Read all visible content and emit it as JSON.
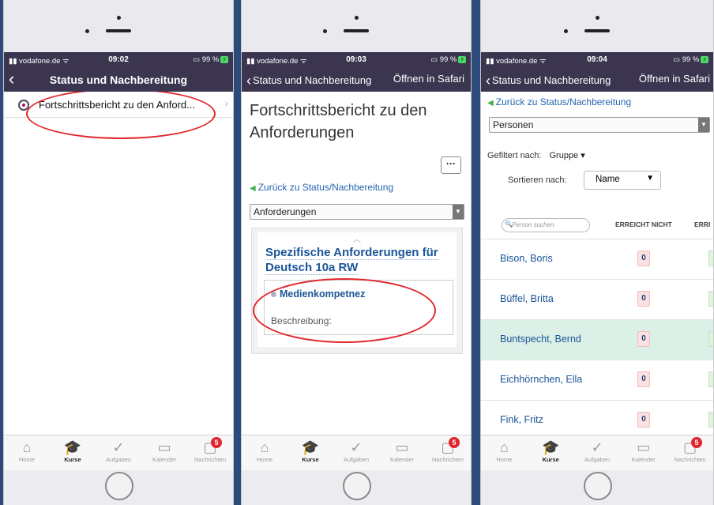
{
  "status": {
    "carrier": "vodafone.de",
    "battery": "99 %",
    "times": [
      "09:02",
      "09:03",
      "09:04"
    ]
  },
  "screen1": {
    "nav_title": "Status und Nachbereitung",
    "item_label": "Fortschrittsbericht zu den Anford..."
  },
  "screen2": {
    "nav_back": "Status und Nachbereitung",
    "nav_right": "Öffnen in Safari",
    "heading": "Fortschrittsbericht zu den Anforderungen",
    "more_button": "···",
    "back_link": "Zurück zu Status/Nachbereitung",
    "select_value": "Anforderungen",
    "spec_title": "Spezifische Anforderungen für Deutsch 10a RW",
    "competence": "Medienkompetnez",
    "description": "Beschreibung:"
  },
  "screen3": {
    "nav_back": "Status und Nachbereitung",
    "nav_right": "Öffnen in Safari",
    "back_link": "Zurück zu Status/Nachbereitung",
    "select_value": "Personen",
    "filter_label": "Gefiltert nach:",
    "filter_value": "Gruppe ▾",
    "sort_label": "Sortieren nach:",
    "sort_value": "Name",
    "search_placeholder": "Person suchen",
    "col_not_reached": "ERREICHT NICHT",
    "col_reached": "ERRI",
    "people": [
      {
        "name": "Bison, Boris",
        "count": "0"
      },
      {
        "name": "Büffel, Britta",
        "count": "0"
      },
      {
        "name": "Buntspecht, Bernd",
        "count": "0"
      },
      {
        "name": "Eichhörnchen, Ella",
        "count": "0"
      },
      {
        "name": "Fink, Fritz",
        "count": "0"
      }
    ]
  },
  "tabs": {
    "home": "Home",
    "kurse": "Kurse",
    "aufgaben": "Aufgaben",
    "kalender": "Kalender",
    "nachrichten": "Nachrichten",
    "badge": "5"
  },
  "colors": {
    "nav_bg": "#3b3550",
    "link": "#2464b0",
    "highlight_ellipse": "#e0262b",
    "row_highlight": "#dbf0e6"
  }
}
